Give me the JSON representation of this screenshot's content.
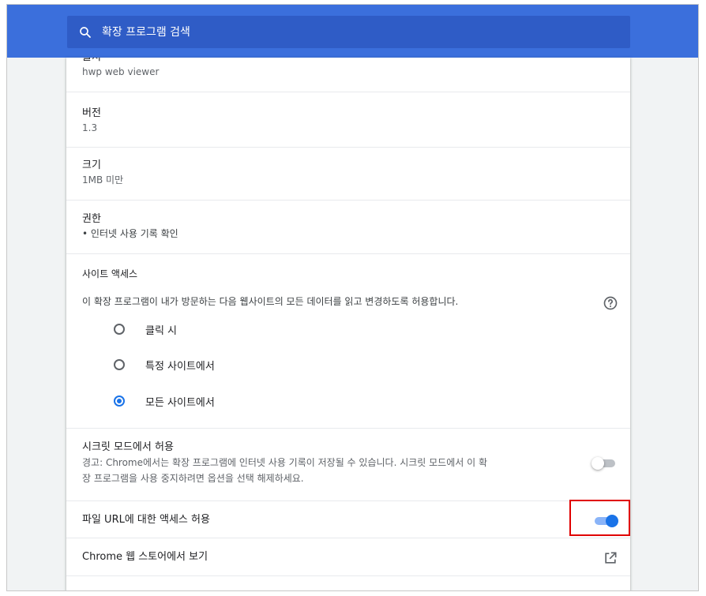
{
  "search": {
    "placeholder": "확장 프로그램 검색"
  },
  "sections": {
    "source": {
      "label": "출처",
      "value": "hwp web viewer"
    },
    "version": {
      "label": "버전",
      "value": "1.3"
    },
    "size": {
      "label": "크기",
      "value": "1MB 미만"
    },
    "permissions": {
      "label": "권한",
      "items": [
        "인터넷 사용 기록 확인"
      ]
    },
    "site_access": {
      "label": "사이트 액세스",
      "description": "이 확장 프로그램이 내가 방문하는 다음 웹사이트의 모든 데이터를 읽고 변경하도록 허용합니다.",
      "options": [
        "클릭 시",
        "특정 사이트에서",
        "모든 사이트에서"
      ],
      "selected": "모든 사이트에서"
    },
    "incognito": {
      "label": "시크릿 모드에서 허용",
      "warning_line1": "경고: Chrome에서는 확장 프로그램에 인터넷 사용 기록이 저장될 수 있습니다. 시크릿 모드에서 이 확",
      "warning_line2": "장 프로그램을 사용 중지하려면 옵션을 선택 해제하세요.",
      "enabled": false
    },
    "file_urls": {
      "label": "파일 URL에 대한 액세스 허용",
      "enabled": true
    },
    "web_store": {
      "label": "Chrome 웹 스토어에서 보기"
    }
  },
  "icons": {
    "search": "search-icon",
    "help": "help-circle-icon",
    "external_link": "open-in-new-icon"
  },
  "colors": {
    "header": "#3b6fdc",
    "accent": "#1a73e8",
    "highlight": "#e00000"
  }
}
